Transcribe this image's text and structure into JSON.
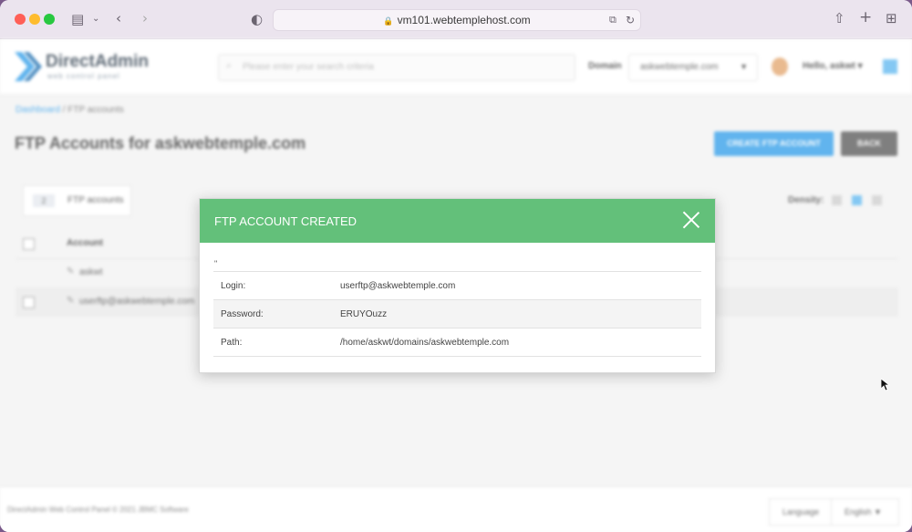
{
  "browser": {
    "url": "vm101.webtemplehost.com"
  },
  "header": {
    "logo_text": "DirectAdmin",
    "logo_sub": "web control panel",
    "search_placeholder": "Please enter your search criteria",
    "domain_label": "Domain",
    "domain_value": "askwebtemple.com",
    "greeting": "Hello, askwt"
  },
  "breadcrumb": {
    "home": "Dashboard",
    "separator": " / ",
    "current": "FTP accounts"
  },
  "page": {
    "title": "FTP Accounts for askwebtemple.com",
    "create_button": "CREATE FTP ACCOUNT",
    "back_button": "BACK",
    "tab_count": "2",
    "tab_label": "FTP accounts",
    "density_label": "Density:",
    "table_header": "Account",
    "rows": [
      "askwt",
      "userftp@askwebtemple.com"
    ]
  },
  "footer": {
    "copyright": "DirectAdmin Web Control Panel © 2021 JBMC Software",
    "language_label": "Language",
    "language_value": "English"
  },
  "modal": {
    "title": "FTP ACCOUNT CREATED",
    "quote": "\"",
    "fields": [
      {
        "label": "Login:",
        "value": "userftp@askwebtemple.com"
      },
      {
        "label": "Password:",
        "value": "ERUYOuzz"
      },
      {
        "label": "Path:",
        "value": "/home/askwt/domains/askwebtemple.com"
      }
    ]
  },
  "colors": {
    "modal_header": "#63c07a",
    "primary": "#2c9be8"
  }
}
